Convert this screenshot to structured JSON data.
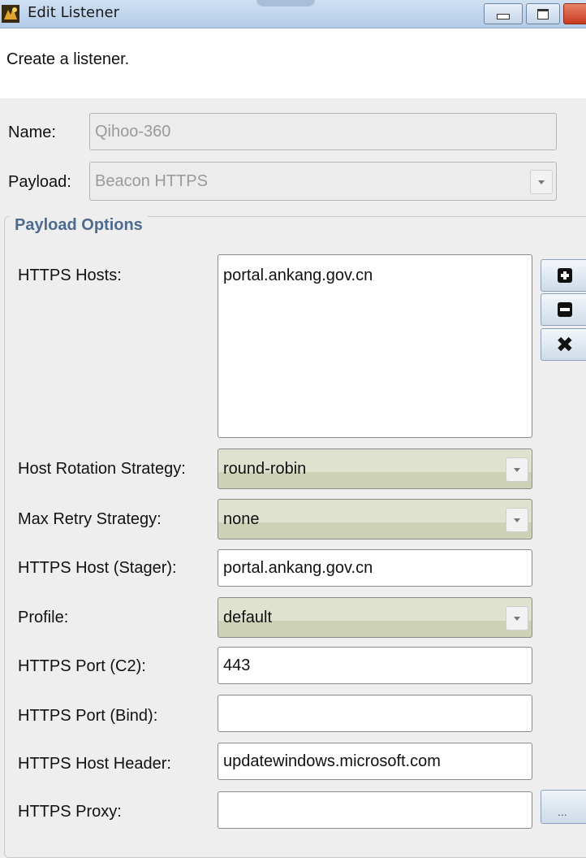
{
  "window": {
    "title": "Edit Listener",
    "minimize_icon": "minimize-icon",
    "maximize_icon": "maximize-icon",
    "close_icon": "close-icon",
    "close_color": "#c83a1f"
  },
  "description": "Create a listener.",
  "name_field": {
    "label": "Name:",
    "value": "Qihoo-360"
  },
  "payload_field": {
    "label": "Payload:",
    "value": "Beacon HTTPS"
  },
  "payload_options": {
    "title": "Payload Options",
    "https_hosts": {
      "label": "HTTPS Hosts:",
      "items": [
        "portal.ankang.gov.cn"
      ]
    },
    "host_buttons": [
      "add-icon",
      "remove-icon",
      "clear-icon"
    ],
    "host_rotation": {
      "label": "Host Rotation Strategy:",
      "value": "round-robin"
    },
    "max_retry": {
      "label": "Max Retry Strategy:",
      "value": "none"
    },
    "stager_host": {
      "label": "HTTPS Host (Stager):",
      "value": "portal.ankang.gov.cn"
    },
    "profile": {
      "label": "Profile:",
      "value": "default"
    },
    "port_c2": {
      "label": "HTTPS Port (C2):",
      "value": "443"
    },
    "port_bind": {
      "label": "HTTPS Port (Bind):",
      "value": ""
    },
    "host_header": {
      "label": "HTTPS Host Header:",
      "value": "updatewindows.microsoft.com"
    },
    "proxy": {
      "label": "HTTPS Proxy:",
      "value": "",
      "button_label": "..."
    }
  },
  "colors": {
    "title_bar": "#b3cbe6",
    "group_title": "#4e6b8f",
    "combo_fill": "#dfe2cf"
  }
}
